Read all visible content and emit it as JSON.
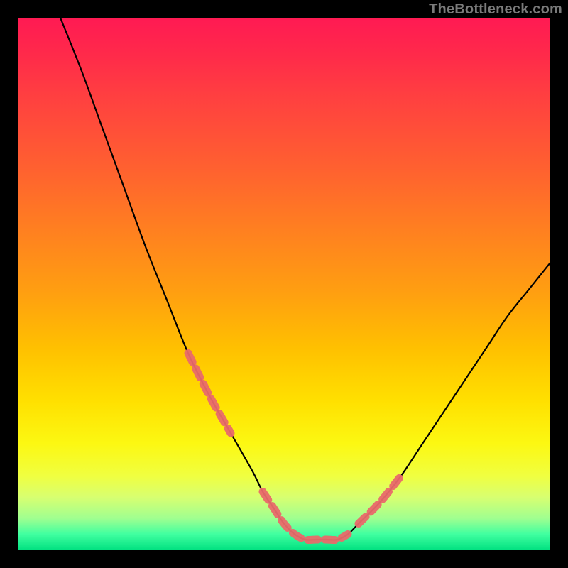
{
  "watermark": "TheBottleneck.com",
  "chart_data": {
    "type": "line",
    "title": "",
    "xlabel": "",
    "ylabel": "",
    "xlim": [
      0,
      100
    ],
    "ylim": [
      0,
      100
    ],
    "series": [
      {
        "name": "bottleneck-curve",
        "x": [
          8,
          12,
          16,
          20,
          24,
          28,
          32,
          36,
          40,
          44,
          46,
          48,
          50,
          52,
          54,
          56,
          58,
          60,
          62,
          64,
          68,
          72,
          76,
          80,
          84,
          88,
          92,
          96,
          100
        ],
        "values": [
          100,
          90,
          79,
          68,
          57,
          47,
          37,
          29,
          22,
          15,
          11,
          8,
          5,
          3,
          2,
          2,
          2,
          2,
          3,
          5,
          9,
          14,
          20,
          26,
          32,
          38,
          44,
          49,
          54
        ]
      }
    ],
    "highlight_segments": [
      {
        "x_range": [
          32,
          40
        ],
        "side": "left"
      },
      {
        "x_range": [
          46,
          62
        ],
        "side": "bottom"
      },
      {
        "x_range": [
          64,
          72
        ],
        "side": "right"
      }
    ],
    "colors": {
      "curve": "#000000",
      "highlight": "#e96a6a",
      "gradient_top": "#ff1a53",
      "gradient_bottom": "#00e080"
    }
  }
}
